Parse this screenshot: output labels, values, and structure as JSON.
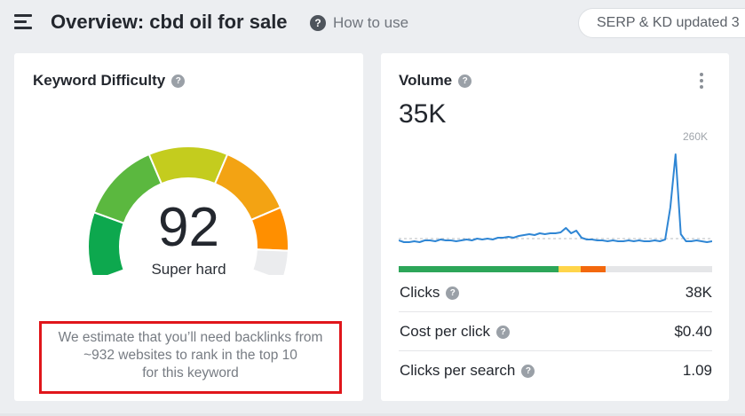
{
  "header": {
    "page_title": "Overview: cbd oil for sale",
    "help_link": "How to use",
    "serp_status": "SERP & KD updated 3"
  },
  "keyword_difficulty": {
    "title": "Keyword Difficulty",
    "value": "92",
    "label": "Super hard",
    "score": 92,
    "estimate_lines": [
      "We estimate that you’ll need backlinks from",
      "~932 websites to rank in the top 10",
      "for this keyword"
    ],
    "gauge_colors": [
      "#0da84e",
      "#5bb83f",
      "#c4cc1e",
      "#f3a313",
      "#ff8f00",
      "#ebecee"
    ]
  },
  "volume": {
    "title": "Volume",
    "value": "35K",
    "max_label": "260K",
    "intent_colors": {
      "green": "#2da659",
      "yellow": "#ffd54a",
      "orange": "#f3680d"
    },
    "line_color": "#2f86d4",
    "metrics": [
      {
        "label": "Clicks",
        "value": "38K"
      },
      {
        "label": "Cost per click",
        "value": "$0.40"
      },
      {
        "label": "Clicks per search",
        "value": "1.09"
      }
    ]
  }
}
